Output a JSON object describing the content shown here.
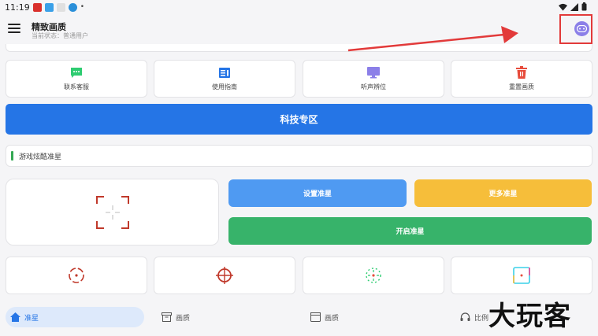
{
  "status_bar": {
    "time": "11:19"
  },
  "app_bar": {
    "title": "精致画质",
    "subtitle": "当前状态：普通用户"
  },
  "tools": [
    {
      "label": "联系客服",
      "icon": "chat-icon",
      "color": "#2ecc71"
    },
    {
      "label": "使用指南",
      "icon": "guide-icon",
      "color": "#2575e6"
    },
    {
      "label": "听声辨位",
      "icon": "monitor-icon",
      "color": "#8b7fe8"
    },
    {
      "label": "重置画质",
      "icon": "trash-icon",
      "color": "#e74c3c"
    }
  ],
  "tech_button": "科技专区",
  "section": {
    "title": "游戏炫酷准星"
  },
  "actions": {
    "set_crosshair": "设置准星",
    "more_crosshair": "更多准星",
    "enable_crosshair": "开启准星"
  },
  "colors": {
    "primary": "#2575e6",
    "set_button": "#4f9af2",
    "more_button": "#f6be3a",
    "enable_button": "#37b36a",
    "highlight": "#e23a3a"
  },
  "nav": [
    {
      "label": "准星",
      "icon": "home-icon",
      "active": true
    },
    {
      "label": "画质",
      "icon": "archive-icon",
      "active": false
    },
    {
      "label": "画质",
      "icon": "box-icon",
      "active": false
    },
    {
      "label": "比例",
      "icon": "headset-icon",
      "active": false
    }
  ],
  "watermark": "大玩客"
}
